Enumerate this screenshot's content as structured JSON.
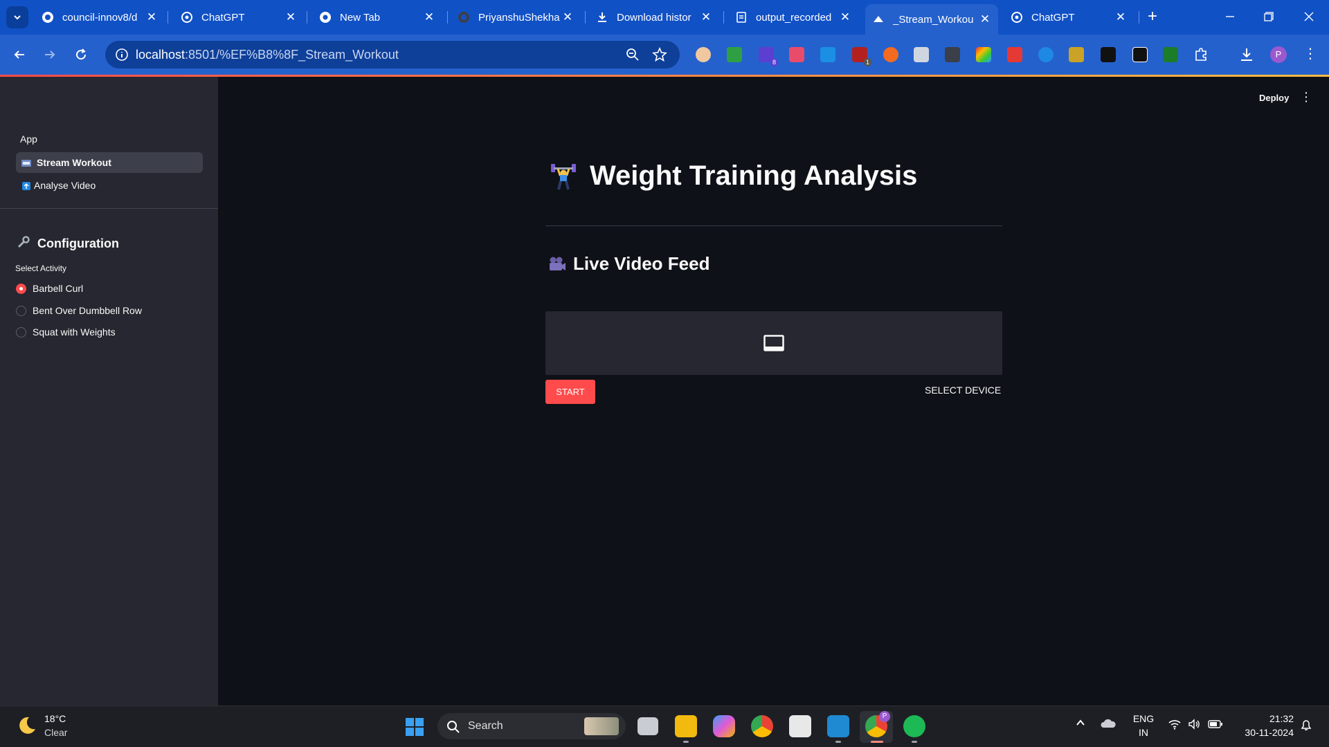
{
  "browser": {
    "tabs": [
      {
        "title": "council-innov8/d",
        "icon": "github-icon"
      },
      {
        "title": "ChatGPT",
        "icon": "chatgpt-icon"
      },
      {
        "title": "New Tab",
        "icon": "chrome-icon"
      },
      {
        "title": "PriyanshuShekha",
        "icon": "github-icon"
      },
      {
        "title": "Download histor",
        "icon": "download-icon"
      },
      {
        "title": "output_recorded",
        "icon": "file-icon"
      },
      {
        "title": "_Stream_Workou",
        "icon": "streamlit-icon",
        "active": true
      },
      {
        "title": "ChatGPT",
        "icon": "chatgpt-icon"
      }
    ],
    "tab_close": "✕",
    "new_tab": "+",
    "url_host": "localhost",
    "url_rest": ":8501/%EF%B8%8F_Stream_Workout",
    "profile_initial": "P",
    "extension_badges": [
      "8",
      "1"
    ]
  },
  "sidebar": {
    "section_label": "App",
    "nav": [
      {
        "label": "Stream Workout",
        "active": true
      },
      {
        "label": "Analyse Video",
        "active": false
      }
    ],
    "config_title": "Configuration",
    "select_label": "Select Activity",
    "activities": [
      {
        "label": "Barbell Curl",
        "selected": true
      },
      {
        "label": "Bent Over Dumbbell Row",
        "selected": false
      },
      {
        "label": "Squat with Weights",
        "selected": false
      }
    ]
  },
  "main": {
    "deploy_label": "Deploy",
    "menu": "⋮",
    "title": "Weight Training Analysis",
    "subheader": "Live Video Feed",
    "start_label": "START",
    "select_device_label": "SELECT DEVICE"
  },
  "taskbar": {
    "temp": "18°C",
    "weather": "Clear",
    "search_placeholder": "Search",
    "lang": "ENG",
    "region": "IN",
    "time": "21:32",
    "date": "30-11-2024",
    "profile_badge": "P"
  },
  "colors": {
    "accent": "#ff4b4b",
    "sidebar_bg": "#262730",
    "main_bg": "#0e1117",
    "chrome_blue": "#2561cc"
  }
}
